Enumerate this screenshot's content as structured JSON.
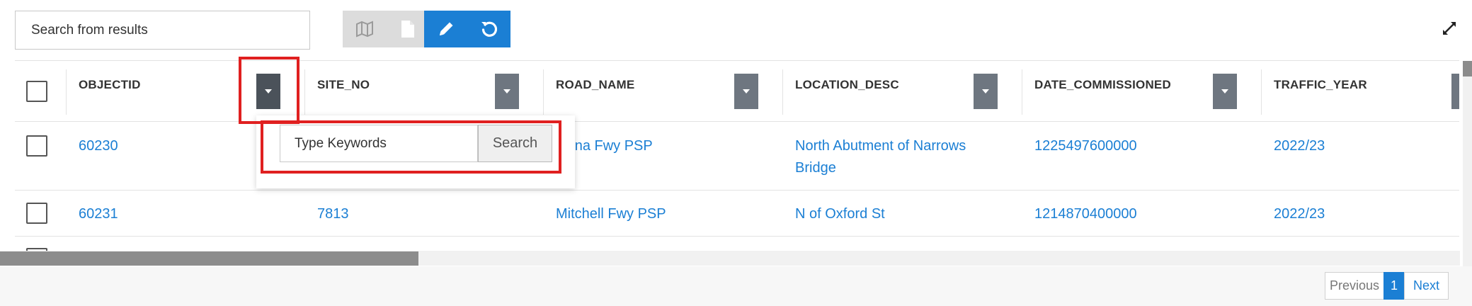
{
  "toolbar": {
    "search_placeholder": "Search from results",
    "buttons": [
      {
        "icon": "map-icon",
        "state": "disabled"
      },
      {
        "icon": "document-icon",
        "state": "disabled"
      },
      {
        "icon": "pencil-icon",
        "state": "active"
      },
      {
        "icon": "refresh-icon",
        "state": "active"
      }
    ],
    "expand_icon": "expand-icon"
  },
  "grid": {
    "columns": [
      "OBJECTID",
      "SITE_NO",
      "ROAD_NAME",
      "LOCATION_DESC",
      "DATE_COMMISSIONED",
      "TRAFFIC_YEAR"
    ],
    "rows": [
      {
        "objectid": "60230",
        "site_no": "",
        "road_name_visible": "inana Fwy PSP",
        "location_desc_line1": "North Abutment of Narrows",
        "location_desc_line2": "Bridge",
        "date_commissioned": "1225497600000",
        "traffic_year": "2022/23"
      },
      {
        "objectid": "60231",
        "site_no": "7813",
        "road_name_visible": "Mitchell Fwy PSP",
        "location_desc_line1": "N of Oxford St",
        "location_desc_line2": "",
        "date_commissioned": "1214870400000",
        "traffic_year": "2022/23"
      }
    ]
  },
  "keyword_popup": {
    "placeholder": "Type Keywords",
    "search_label": "Search"
  },
  "pagination": {
    "previous_label": "Previous",
    "current_page": "1",
    "next_label": "Next"
  },
  "colors": {
    "accent": "#1b7fd4",
    "highlight": "#e02020",
    "filter_button": "#6e7680"
  }
}
